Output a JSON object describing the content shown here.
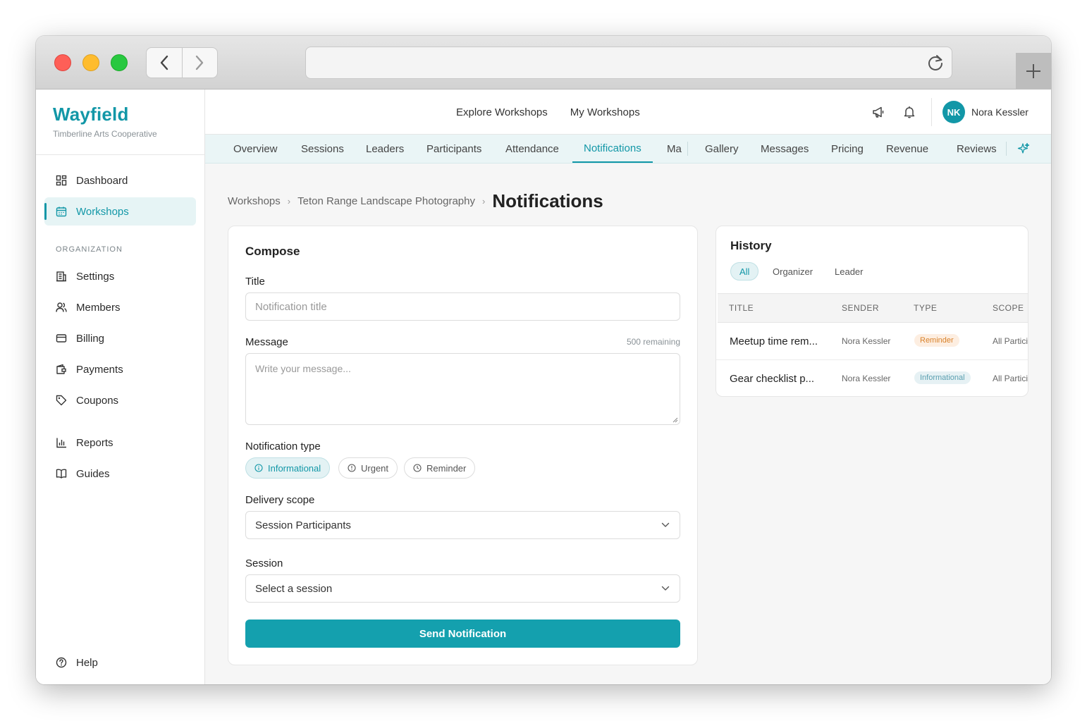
{
  "app": {
    "brand": "Wayfield",
    "organization": "Timberline Arts Cooperative"
  },
  "sidebar": {
    "items": [
      {
        "label": "Dashboard",
        "icon": "grid-icon"
      },
      {
        "label": "Workshops",
        "icon": "calendar-icon",
        "active": true
      }
    ],
    "section_label": "ORGANIZATION",
    "org_items": [
      {
        "label": "Settings",
        "icon": "building-icon"
      },
      {
        "label": "Members",
        "icon": "users-icon"
      },
      {
        "label": "Billing",
        "icon": "card-icon"
      },
      {
        "label": "Payments",
        "icon": "wallet-icon"
      },
      {
        "label": "Coupons",
        "icon": "tag-icon"
      }
    ],
    "extra_items": [
      {
        "label": "Reports",
        "icon": "bar-chart-icon"
      },
      {
        "label": "Guides",
        "icon": "book-icon"
      }
    ],
    "help": "Help"
  },
  "topnav": {
    "links": [
      "Explore Workshops",
      "My Workshops"
    ],
    "user_initials": "NK",
    "user_name": "Nora Kessler"
  },
  "tabs": [
    "Overview",
    "Sessions",
    "Leaders",
    "Participants",
    "Attendance",
    "Notifications",
    "Ma",
    "Gallery",
    "Messages",
    "Pricing",
    "Revenue",
    "Reviews"
  ],
  "active_tab": "Notifications",
  "breadcrumb": {
    "items": [
      "Workshops",
      "Teton Range Landscape Photography"
    ],
    "current": "Notifications"
  },
  "compose": {
    "heading": "Compose",
    "title_label": "Title",
    "title_placeholder": "Notification title",
    "message_label": "Message",
    "remaining": "500 remaining",
    "message_placeholder": "Write your message...",
    "type_label": "Notification type",
    "types": [
      "Informational",
      "Urgent",
      "Reminder"
    ],
    "selected_type": "Informational",
    "scope_label": "Delivery scope",
    "scope_value": "Session Participants",
    "session_label": "Session",
    "session_placeholder": "Select a session",
    "send_label": "Send Notification"
  },
  "history": {
    "heading": "History",
    "filters": [
      "All",
      "Organizer",
      "Leader"
    ],
    "active_filter": "All",
    "columns": [
      "TITLE",
      "SENDER",
      "TYPE",
      "SCOPE"
    ],
    "rows": [
      {
        "title": "Meetup time rem...",
        "sender": "Nora Kessler",
        "type": "Reminder",
        "scope": "All Partici"
      },
      {
        "title": "Gear checklist p...",
        "sender": "Nora Kessler",
        "type": "Informational",
        "scope": "All Partici"
      }
    ]
  },
  "colors": {
    "accent": "#1297a7",
    "button": "#14a0ae",
    "reminder_badge": "#d9822b",
    "info_badge": "#5a9fb0"
  }
}
